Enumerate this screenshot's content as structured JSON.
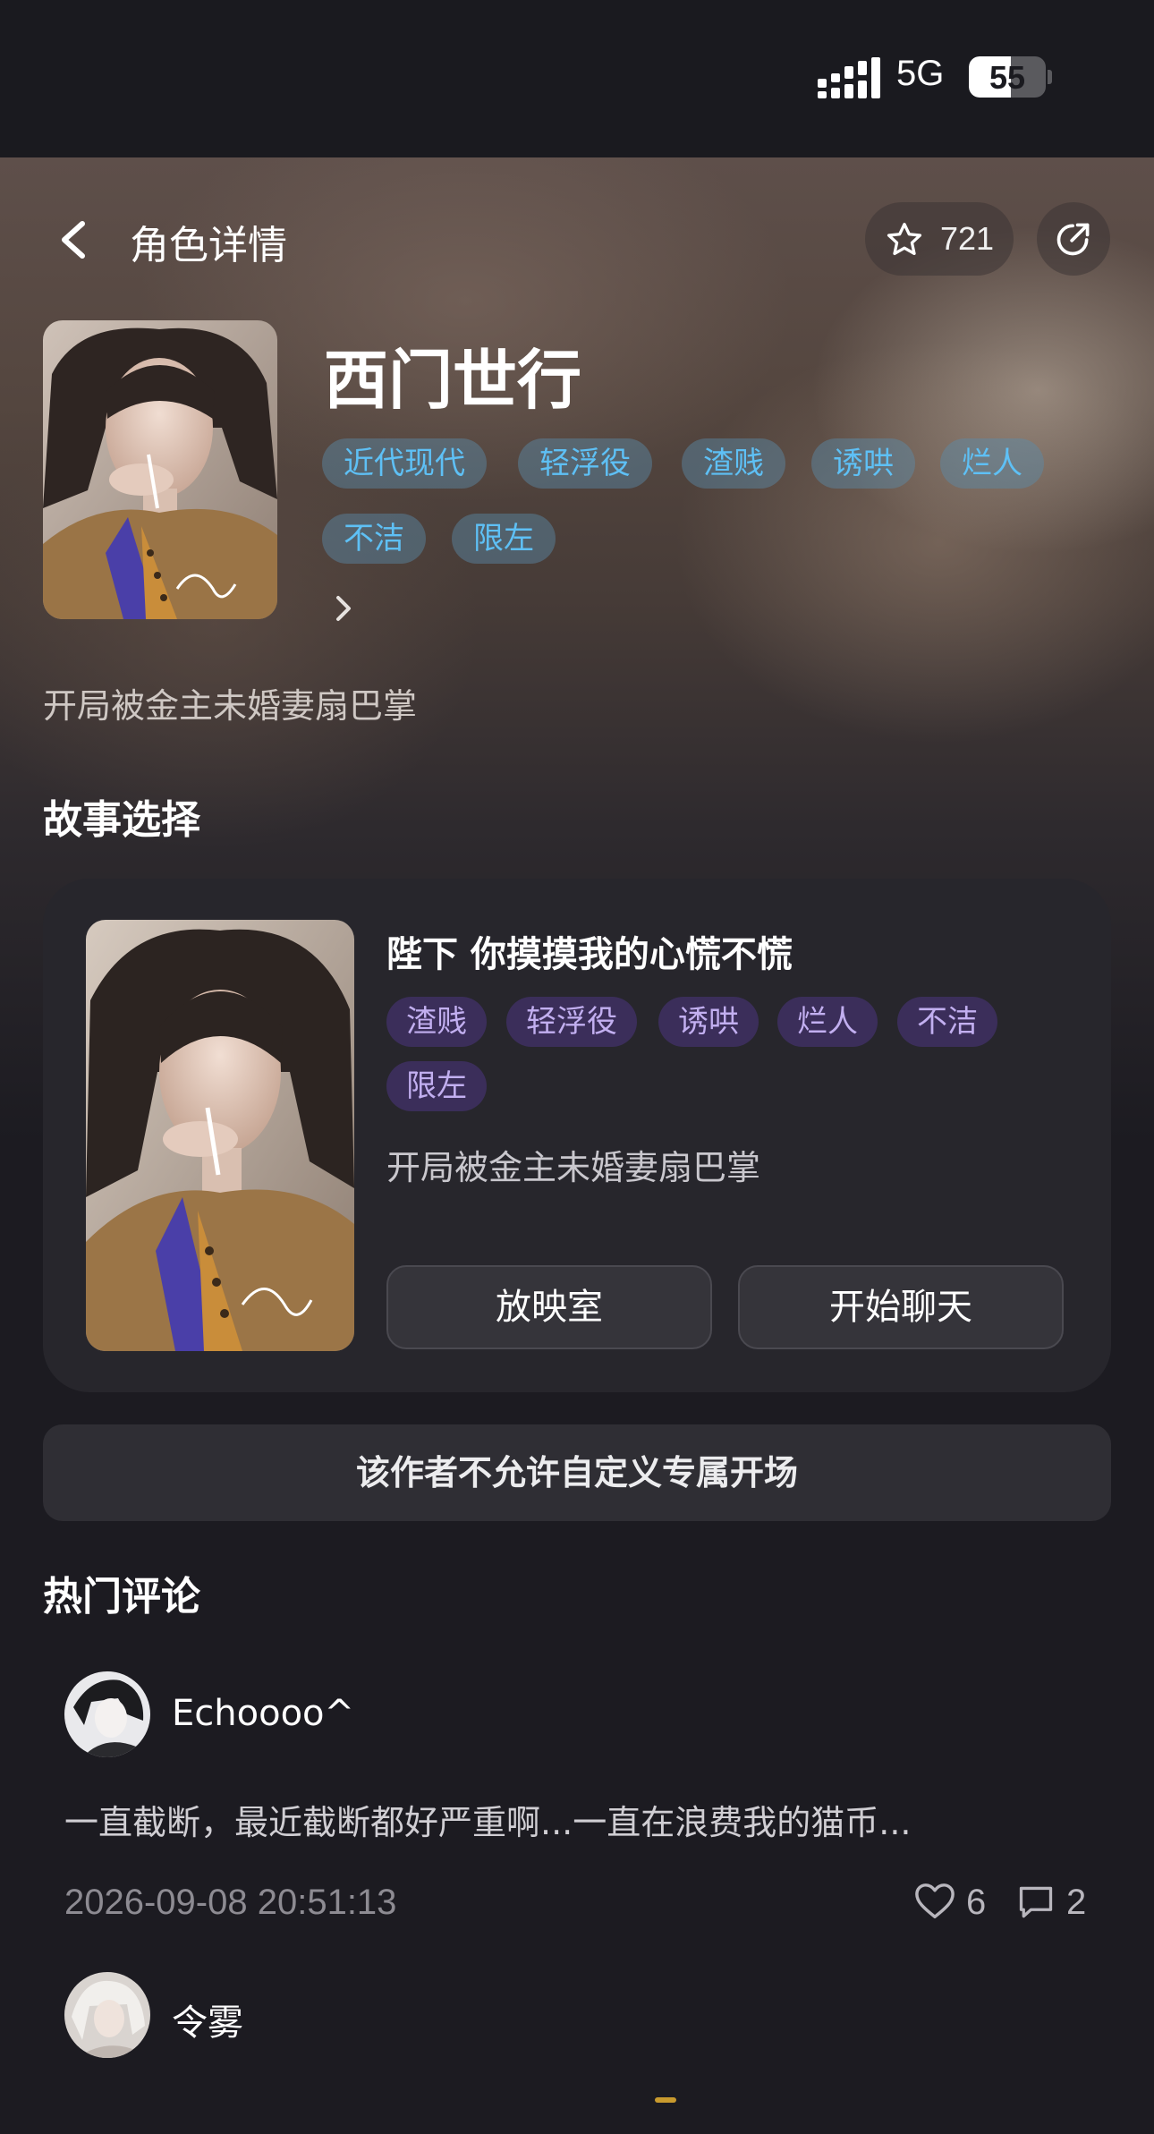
{
  "status_bar": {
    "network": "5G",
    "battery": "55",
    "battery_level": 0.55
  },
  "nav": {
    "back_icon": "chevron-left-icon",
    "title": "角色详情",
    "favorite_icon": "star-outline-icon",
    "favorite_count": "721",
    "share_icon": "share-arrow-icon"
  },
  "character": {
    "name": "西门世行",
    "tags": [
      "近代现代",
      "轻浮役",
      "渣贱",
      "诱哄",
      "烂人",
      "不洁",
      "限左"
    ],
    "expand_icon": "chevron-right-icon",
    "subtitle": "开局被金主未婚妻扇巴掌"
  },
  "story_section": {
    "title": "故事选择",
    "card": {
      "title": "陛下 你摸摸我的心慌不慌",
      "tags": [
        "渣贱",
        "轻浮役",
        "诱哄",
        "烂人",
        "不洁",
        "限左"
      ],
      "description": "开局被金主未婚妻扇巴掌",
      "theater_button": "放映室",
      "chat_button": "开始聊天"
    },
    "notice": "该作者不允许自定义专属开场"
  },
  "comments_section": {
    "title": "热门评论",
    "comments": [
      {
        "user": "Echoooo^",
        "text": "一直截断，最近截断都好严重啊...一直在浪费我的猫币...",
        "time": "2026-09-08 20:51:13",
        "likes": "6",
        "replies": "2",
        "like_icon": "heart-outline-icon",
        "reply_icon": "comment-bubble-icon"
      },
      {
        "user": "令雾"
      }
    ]
  },
  "colors": {
    "background": "#1c1b21",
    "tag_blue_text": "#5ec0f5",
    "tag_purple_bg": "#3b2e5a",
    "tag_purple_text": "#c2aff0",
    "card_bg": "#27262c"
  }
}
